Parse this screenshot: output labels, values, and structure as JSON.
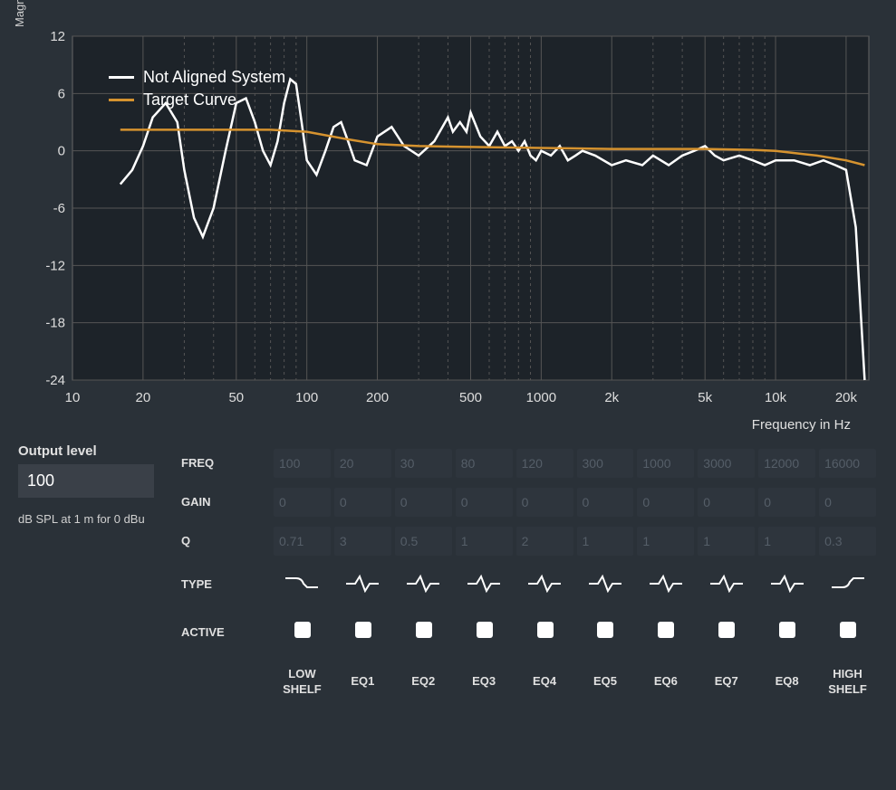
{
  "chart": {
    "ylabel": "Magnitude in d",
    "xlabel": "Frequency in Hz",
    "xticks": [
      "10",
      "20",
      "50",
      "100",
      "200",
      "500",
      "1000",
      "2k",
      "5k",
      "10k",
      "20k"
    ],
    "yticks": [
      12,
      6,
      0,
      -6,
      -12,
      -18,
      -24
    ],
    "legend": [
      {
        "label": "Not Aligned System",
        "color": "#ffffff"
      },
      {
        "label": "Target Curve",
        "color": "#d6932f"
      }
    ]
  },
  "chart_data": {
    "type": "line",
    "title": "",
    "xlabel": "Frequency in Hz",
    "ylabel": "Magnitude in dB",
    "xlim": [
      10,
      25000
    ],
    "ylim": [
      -24,
      12
    ],
    "xscale": "log",
    "series": [
      {
        "name": "Not Aligned System",
        "color": "#ffffff",
        "x": [
          16,
          18,
          20,
          22,
          25,
          28,
          30,
          33,
          36,
          40,
          45,
          50,
          55,
          60,
          65,
          70,
          75,
          80,
          85,
          90,
          95,
          100,
          110,
          120,
          130,
          140,
          150,
          160,
          180,
          200,
          230,
          260,
          300,
          350,
          400,
          420,
          450,
          480,
          500,
          550,
          600,
          650,
          700,
          750,
          800,
          850,
          900,
          950,
          1000,
          1100,
          1200,
          1300,
          1400,
          1500,
          1700,
          2000,
          2300,
          2700,
          3000,
          3500,
          4000,
          4500,
          5000,
          5500,
          6000,
          7000,
          8000,
          9000,
          10000,
          12000,
          14000,
          16000,
          18000,
          20000,
          22000,
          24000
        ],
        "y": [
          -3.5,
          -2.0,
          0.5,
          3.5,
          5.0,
          3.0,
          -2.0,
          -7.0,
          -9.0,
          -6.0,
          0.0,
          5.0,
          5.5,
          3.0,
          0.0,
          -1.5,
          1.0,
          5.0,
          7.5,
          7.0,
          3.0,
          -1.0,
          -2.5,
          0.0,
          2.5,
          3.0,
          1.0,
          -1.0,
          -1.5,
          1.5,
          2.5,
          0.5,
          -0.5,
          1.0,
          3.5,
          2.0,
          3.0,
          2.0,
          4.0,
          1.5,
          0.5,
          2.0,
          0.5,
          1.0,
          0.0,
          1.0,
          -0.5,
          -1.0,
          0.0,
          -0.5,
          0.5,
          -1.0,
          -0.5,
          0.0,
          -0.5,
          -1.5,
          -1.0,
          -1.5,
          -0.5,
          -1.5,
          -0.5,
          0.0,
          0.5,
          -0.5,
          -1.0,
          -0.5,
          -1.0,
          -1.5,
          -1.0,
          -1.0,
          -1.5,
          -1.0,
          -1.5,
          -2.0,
          -8.0,
          -24.0
        ]
      },
      {
        "name": "Target Curve",
        "color": "#d6932f",
        "x": [
          16,
          20,
          30,
          50,
          70,
          100,
          150,
          200,
          300,
          500,
          1000,
          2000,
          5000,
          8000,
          10000,
          15000,
          20000,
          24000
        ],
        "y": [
          2.2,
          2.2,
          2.2,
          2.2,
          2.2,
          2.0,
          1.2,
          0.7,
          0.5,
          0.4,
          0.3,
          0.2,
          0.2,
          0.1,
          0.0,
          -0.5,
          -1.0,
          -1.5
        ]
      }
    ]
  },
  "output": {
    "label": "Output level",
    "value": "100",
    "unit": "dB SPL at 1 m for 0 dBu"
  },
  "eq": {
    "rows": {
      "freq": "FREQ",
      "gain": "GAIN",
      "q": "Q",
      "type": "TYPE",
      "active": "ACTIVE"
    },
    "bands": [
      {
        "name": "LOW\nSHELF",
        "freq": "100",
        "gain": "0",
        "q": "0.71",
        "type": "lowshelf",
        "active": false
      },
      {
        "name": "EQ1",
        "freq": "20",
        "gain": "0",
        "q": "3",
        "type": "peak",
        "active": false
      },
      {
        "name": "EQ2",
        "freq": "30",
        "gain": "0",
        "q": "0.5",
        "type": "peak",
        "active": false
      },
      {
        "name": "EQ3",
        "freq": "80",
        "gain": "0",
        "q": "1",
        "type": "peak",
        "active": false
      },
      {
        "name": "EQ4",
        "freq": "120",
        "gain": "0",
        "q": "2",
        "type": "peak",
        "active": false
      },
      {
        "name": "EQ5",
        "freq": "300",
        "gain": "0",
        "q": "1",
        "type": "peak",
        "active": false
      },
      {
        "name": "EQ6",
        "freq": "1000",
        "gain": "0",
        "q": "1",
        "type": "peak",
        "active": false
      },
      {
        "name": "EQ7",
        "freq": "3000",
        "gain": "0",
        "q": "1",
        "type": "peak",
        "active": false
      },
      {
        "name": "EQ8",
        "freq": "12000",
        "gain": "0",
        "q": "1",
        "type": "peak",
        "active": false
      },
      {
        "name": "HIGH\nSHELF",
        "freq": "16000",
        "gain": "0",
        "q": "0.3",
        "type": "highshelf",
        "active": false
      }
    ]
  }
}
